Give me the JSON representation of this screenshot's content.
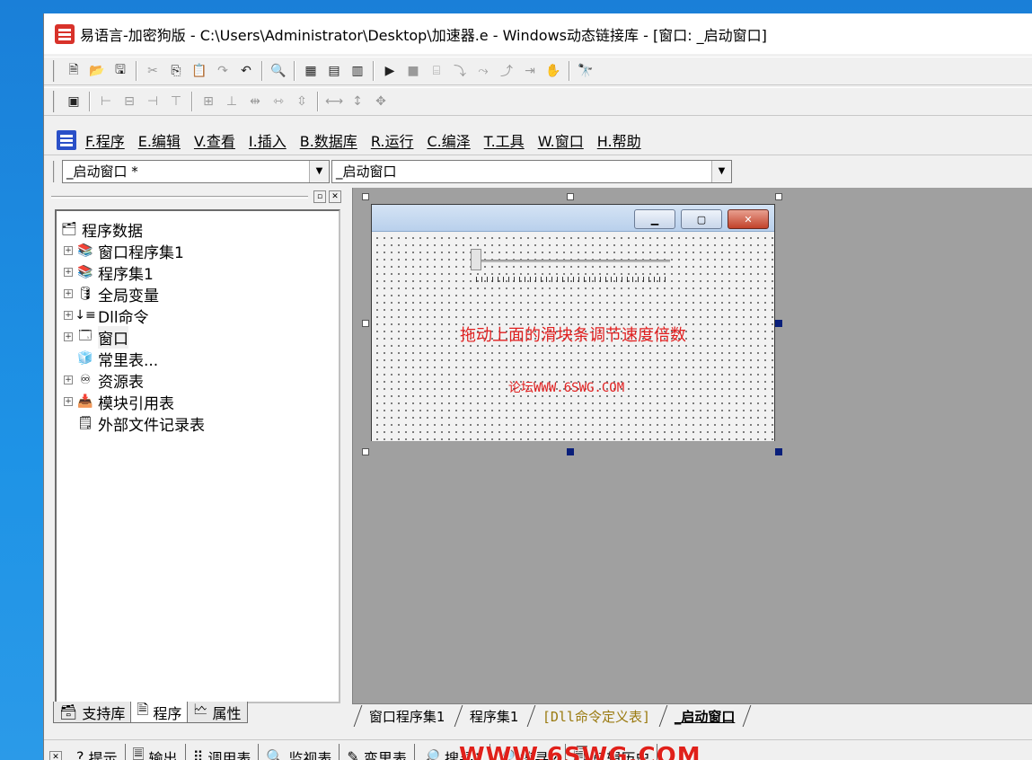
{
  "window": {
    "title": "易语言-加密狗版 - C:\\Users\\Administrator\\Desktop\\加速器.e - Windows动态链接库 - [窗口: _启动窗口]"
  },
  "toolbar1": {
    "icons": [
      "new-file-icon",
      "open-folder-icon",
      "save-icon",
      "cut-icon",
      "copy-icon",
      "paste-icon",
      "redo-icon",
      "undo-icon",
      "find-icon",
      "layout-1-icon",
      "layout-2-icon",
      "layout-3-icon",
      "run-icon",
      "stop-icon",
      "debug-1-icon",
      "step-into-icon",
      "step-over-icon",
      "step-out-icon",
      "run-to-cursor-icon",
      "hand-icon",
      "search-binoculars-icon"
    ]
  },
  "toolbar2": {
    "icons": [
      "align-panel-icon",
      "align-left-icon",
      "align-center-icon",
      "align-right-icon",
      "align-top-icon",
      "align-middle-icon",
      "align-bottom-icon",
      "same-width-icon",
      "space-h-icon",
      "space-v-icon",
      "center-h-icon",
      "center-v-icon",
      "center-both-icon"
    ]
  },
  "menu": [
    {
      "label": "F.程序"
    },
    {
      "label": "E.编辑"
    },
    {
      "label": "V.查看"
    },
    {
      "label": "I.插入"
    },
    {
      "label": "B.数据库"
    },
    {
      "label": "R.运行"
    },
    {
      "label": "C.编泽"
    },
    {
      "label": "T.工具"
    },
    {
      "label": "W.窗口"
    },
    {
      "label": "H.帮助"
    }
  ],
  "combos": {
    "left": "_启动窗口 *",
    "right": "_启动窗口"
  },
  "tree": {
    "root": "程序数据",
    "nodes": [
      {
        "label": "窗口程序集1",
        "icon": "module-icon"
      },
      {
        "label": "程序集1",
        "icon": "module-icon"
      },
      {
        "label": "全局变量",
        "icon": "variable-icon"
      },
      {
        "label": "Dll命令",
        "icon": "dll-icon"
      },
      {
        "label": "窗口",
        "icon": "window-icon"
      },
      {
        "label": "常里表...",
        "icon": "constant-icon"
      },
      {
        "label": "资源表",
        "icon": "resource-icon"
      },
      {
        "label": "模块引用表",
        "icon": "module-ref-icon"
      },
      {
        "label": "外部文件记录表",
        "icon": "file-record-icon"
      }
    ]
  },
  "form": {
    "hint_text": "拖动上面的滑块条调节速度倍数",
    "url_text": "论坛WWW.6SWG.COM"
  },
  "left_tabs": [
    {
      "label": "支持库",
      "icon": "library-icon"
    },
    {
      "label": "程序",
      "icon": "program-icon"
    },
    {
      "label": "属性",
      "icon": "properties-icon"
    }
  ],
  "doc_tabs": [
    {
      "label": "窗口程序集1"
    },
    {
      "label": "程序集1"
    },
    {
      "label": "[Dll命令定义表]"
    },
    {
      "label": "_启动窗口"
    }
  ],
  "bottom_tabs": [
    {
      "label": "提示",
      "icon": "help-icon"
    },
    {
      "label": "输出",
      "icon": "output-icon"
    },
    {
      "label": "调用表",
      "icon": "call-stack-icon"
    },
    {
      "label": "监视表",
      "icon": "watch-icon"
    },
    {
      "label": "变里表",
      "icon": "variables-icon"
    },
    {
      "label": "搜寻1",
      "icon": "search-icon"
    },
    {
      "label": "搜寻2",
      "icon": "search-icon"
    },
    {
      "label": "剪辑历史",
      "icon": "clipboard-icon"
    }
  ],
  "watermark": "WWW.6SWG.COM",
  "colors": {
    "hint": "#e02020",
    "accent": "#0a1f7a"
  }
}
